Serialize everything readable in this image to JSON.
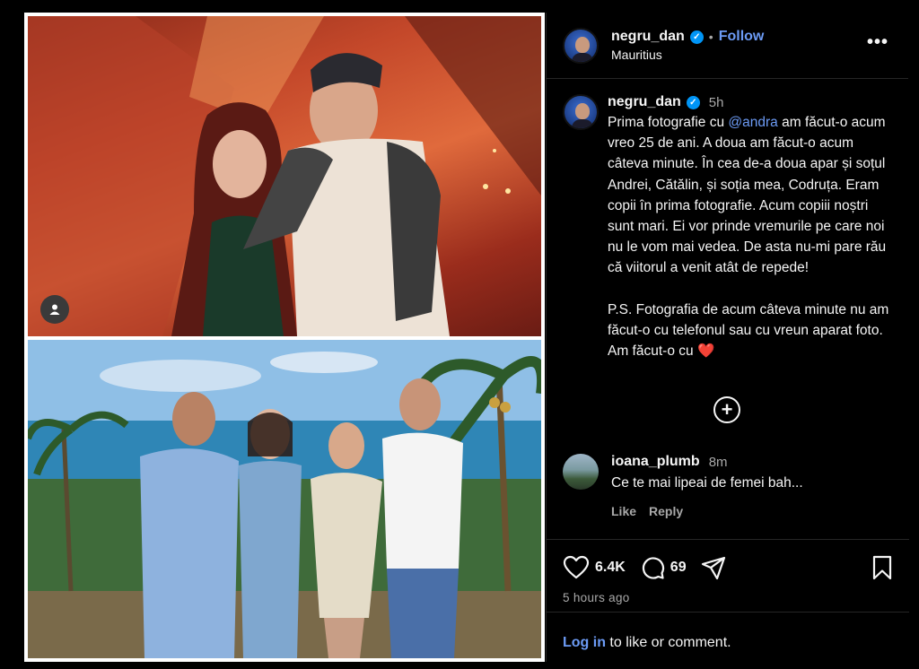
{
  "post": {
    "author": "negru_dan",
    "follow_label": "Follow",
    "location": "Mauritius",
    "more_label": "•••",
    "caption": {
      "author": "negru_dan",
      "time": "5h",
      "text_before": "Prima fotografie cu ",
      "mention": "@andra",
      "text_after": " am făcut-o acum vreo 25 de ani. A doua am făcut-o acum câteva minute. În cea de-a doua apar și soțul Andrei, Cătălin, și soția mea, Codruța. Eram copii în prima fotografie. Acum copiii noștri sunt mari. Ei vor prinde vremurile pe care noi nu le vom mai vedea. De asta nu-mi pare rău că viitorul a venit atât de repede!\n\nP.S. Fotografia de acum câteva minute nu am făcut-o cu telefonul sau cu vreun aparat foto. Am făcut-o cu ",
      "emoji": "❤️"
    },
    "load_more_label": "+",
    "comment": {
      "author": "ioana_plumb",
      "time": "8m",
      "text": "Ce te mai lipeai de femei bah...",
      "like_label": "Like",
      "reply_label": "Reply"
    },
    "likes": "6.4K",
    "comments_count": "69",
    "posted_ago": "5 hours ago",
    "login": {
      "link": "Log in",
      "rest": " to like or comment."
    }
  },
  "colors": {
    "link": "#6c9bf5",
    "verified": "#0095f6",
    "background": "#000000"
  },
  "icons": [
    "verified-badge-icon",
    "more-options-icon",
    "add-circle-icon",
    "heart-icon",
    "comment-icon",
    "share-icon",
    "bookmark-icon",
    "user-tag-icon"
  ]
}
